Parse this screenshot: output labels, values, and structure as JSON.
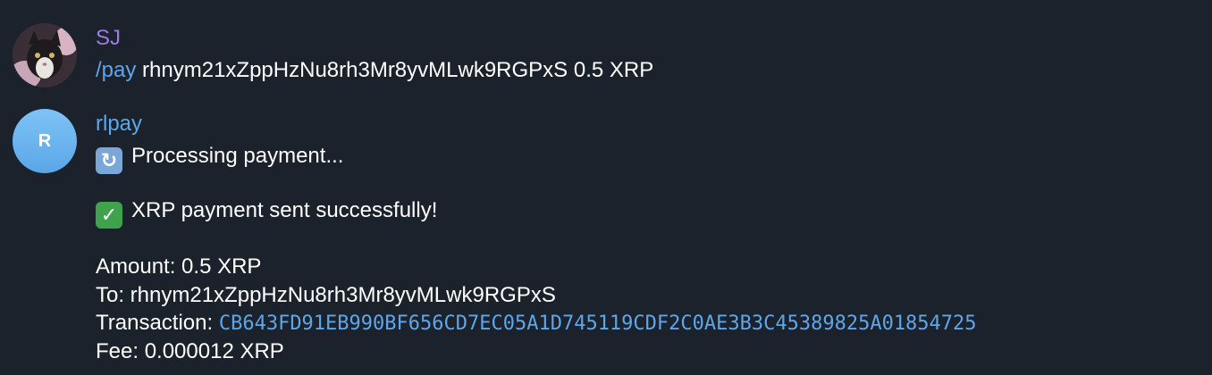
{
  "messages": [
    {
      "sender": "SJ",
      "avatar_icon": "cat-photo-avatar",
      "command": "/pay",
      "text": " rhnym21xZppHzNu8rh3Mr8yvMLwk9RGPxS 0.5 XRP"
    },
    {
      "sender": "rlpay",
      "avatar_letter": "R",
      "processing_icon": "refresh-emoji-icon",
      "processing_text": "Processing payment...",
      "success_icon": "check-mark-emoji-icon",
      "success_text": "XRP payment sent successfully!",
      "amount_line": "Amount: 0.5 XRP",
      "to_line": "To: rhnym21xZppHzNu8rh3Mr8yvMLwk9RGPxS",
      "transaction_label": "Transaction: ",
      "transaction_hash": "CB643FD91EB990BF656CD7EC05A1D745119CDF2C0AE3B3C45389825A01854725",
      "fee_line": "Fee: 0.000012 XRP"
    }
  ],
  "colors": {
    "background": "#1b222b",
    "sender_sj": "#9b7ce0",
    "sender_bot": "#5fa6e8",
    "link": "#5fa6e8",
    "text": "#ffffff"
  }
}
